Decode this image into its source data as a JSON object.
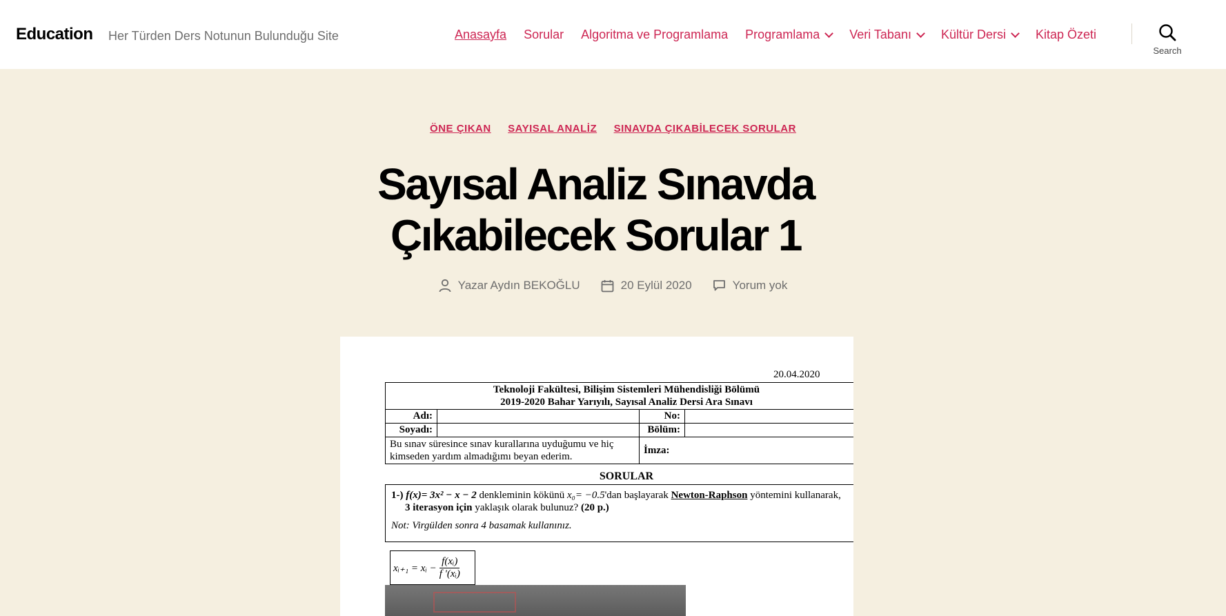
{
  "site": {
    "title": "Education",
    "description": "Her Türden Ders Notunun Bulunduğu Site"
  },
  "nav": {
    "items": [
      {
        "label": "Anasayfa",
        "current": true,
        "has_submenu": false
      },
      {
        "label": "Sorular",
        "current": false,
        "has_submenu": false
      },
      {
        "label": "Algoritma ve Programlama",
        "current": false,
        "has_submenu": false
      },
      {
        "label": "Programlama",
        "current": false,
        "has_submenu": true
      },
      {
        "label": "Veri Tabanı",
        "current": false,
        "has_submenu": true
      },
      {
        "label": "Kültür Dersi",
        "current": false,
        "has_submenu": true
      },
      {
        "label": "Kitap Özeti",
        "current": false,
        "has_submenu": false
      }
    ],
    "search_label": "Search",
    "search_icon": "search-icon"
  },
  "post": {
    "categories": [
      "ÖNE ÇIKAN",
      "SAYISAL ANALİZ",
      "SINAVDA ÇIKABİLECEK SORULAR"
    ],
    "title_line1": "Sayısal Analiz Sınavda",
    "title_line2": "Çıkabilecek Sorular 1",
    "author": "Yazar Aydın BEKOĞLU",
    "date": "20 Eylül 2020",
    "comments": "Yorum yok"
  },
  "document": {
    "date": "20.04.2020",
    "header_line1": "Teknoloji Fakültesi, Bilişim Sistemleri Mühendisliği Bölümü",
    "header_line2": "2019-2020 Bahar Yarıyılı, Sayısal Analiz Dersi Ara Sınavı",
    "label_name": "Adı:",
    "label_no": "No:",
    "label_surname": "Soyadı:",
    "label_dept": "Bölüm:",
    "declaration": "Bu sınav süresince sınav kurallarına uyduğumu ve hiç kimseden yardım almadığımı beyan ederim.",
    "label_signature": "İmza:",
    "questions_heading": "SORULAR",
    "q1_prefix": "1-)",
    "q1_function": "f(x)= 3x² − x − 2",
    "q1_text_a": "denkleminin kökünü",
    "q1_x0": "x₀= −0.5",
    "q1_text_b": "'dan başlayarak",
    "q1_method": "Newton-Raphson",
    "q1_text_c": "yöntemini kullanarak,",
    "q1_iterations": "3 iterasyon için",
    "q1_text_d": "yaklaşık olarak bulunuz?",
    "q1_points": "(20 p.)",
    "note": "Not: Virgülden sonra 4 basamak kullanınız.",
    "formula_lhs": "xᵢ₊₁ = xᵢ −",
    "formula_num": "f(xᵢ)",
    "formula_den": "f '(xᵢ)"
  },
  "colors": {
    "accent": "#cd2653",
    "background": "#f5efe0",
    "header_bg": "#ffffff",
    "meta_text": "#6d6d6d"
  }
}
